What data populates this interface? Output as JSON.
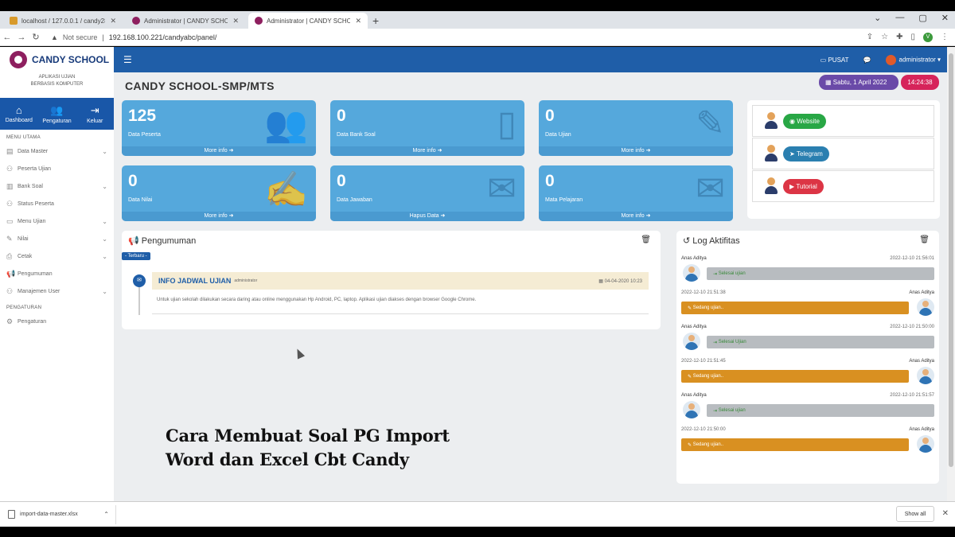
{
  "browser": {
    "tabs": [
      {
        "title": "localhost / 127.0.0.1 / candy28...",
        "active": false
      },
      {
        "title": "Administrator | CANDY SCHOOL",
        "active": false
      },
      {
        "title": "Administrator | CANDY SCHOOL",
        "active": true
      }
    ],
    "new_tab": "+",
    "secure_label": "Not secure",
    "url": "192.168.100.221/candyabc/panel/"
  },
  "sidebar": {
    "brand": "CANDY SCHOOL",
    "tagline": "APLIKASI UJIAN\nBERBASIS KOMPUTER",
    "quick": [
      {
        "label": "Dashboard",
        "icon": "home-icon"
      },
      {
        "label": "Pengaturan",
        "icon": "users-cog-icon"
      },
      {
        "label": "Keluar",
        "icon": "sign-out-icon"
      }
    ],
    "main_header": "MENU UTAMA",
    "items": [
      {
        "label": "Data Master",
        "icon": "database-icon",
        "chevron": true
      },
      {
        "label": "Peserta Ujian",
        "icon": "users-icon",
        "chevron": false
      },
      {
        "label": "Bank Soal",
        "icon": "book-icon",
        "chevron": true
      },
      {
        "label": "Status Peserta",
        "icon": "status-icon",
        "chevron": false
      },
      {
        "label": "Menu Ujian",
        "icon": "monitor-icon",
        "chevron": true
      },
      {
        "label": "Nilai",
        "icon": "grade-icon",
        "chevron": true
      },
      {
        "label": "Cetak",
        "icon": "print-icon",
        "chevron": true
      },
      {
        "label": "Pengumuman",
        "icon": "bullhorn-icon",
        "chevron": false
      },
      {
        "label": "Manajemen User",
        "icon": "user-admin-icon",
        "chevron": true
      }
    ],
    "settings_header": "PENGATURAN",
    "settings_items": [
      {
        "label": "Pengaturan",
        "icon": "settings-icon"
      }
    ]
  },
  "topnav": {
    "pusat_label": "PUSAT",
    "user_label": "administrator"
  },
  "header": {
    "title": "CANDY SCHOOL-SMP/MTS",
    "date": "Sabtu, 1 April 2022",
    "time": "14:24:38"
  },
  "cards": [
    {
      "value": "125",
      "label": "Data Peserta",
      "more": "More info",
      "icon": "users-icon"
    },
    {
      "value": "0",
      "label": "Data Bank Soal",
      "more": "More info",
      "icon": "file-icon"
    },
    {
      "value": "0",
      "label": "Data Ujian",
      "more": "More info",
      "icon": "edit-icon"
    },
    {
      "value": "0",
      "label": "Data Nilai",
      "more": "More info",
      "icon": "signature-icon"
    },
    {
      "value": "0",
      "label": "Data Jawaban",
      "more": "Hapus Data",
      "icon": "envelope-icon"
    },
    {
      "value": "0",
      "label": "Mata Pelajaran",
      "more": "More info",
      "icon": "envelope-open-icon"
    }
  ],
  "links": [
    {
      "label": "Website",
      "color": "#28a745",
      "icon": "globe-icon"
    },
    {
      "label": "Telegram",
      "color": "#2a7fb0",
      "icon": "telegram-icon"
    },
    {
      "label": "Tutorial",
      "color": "#dc3545",
      "icon": "youtube-icon"
    }
  ],
  "announcement": {
    "panel_title": "Pengumuman",
    "badge": "- Terbaru -",
    "title": "INFO JADWAL UJIAN",
    "author": "administrator",
    "date": "04-04-2020 10:23",
    "body": "Untuk ujian sekolah dilakukan secara daring atau online menggunakan Hp Android, PC, laptop. Aplikasi ujian diakses dengan browser Google Chrome."
  },
  "log": {
    "panel_title": "Log Aktifitas",
    "entries": [
      {
        "name": "Anas Aditya",
        "time": "2022-12-10 21:56:01",
        "msg": "Selesai ujian",
        "type": "done",
        "side": "left"
      },
      {
        "name": "Anas Aditya",
        "time": "2022-12-10 21:51:38",
        "msg": "Sedang ujian..",
        "type": "work",
        "side": "right"
      },
      {
        "name": "Anas Aditya",
        "time": "2022-12-10 21:50:00",
        "msg": "Selesai Ujian",
        "type": "done",
        "side": "left"
      },
      {
        "name": "Anas Aditya",
        "time": "2022-12-10 21:51:45",
        "msg": "Sedang ujian..",
        "type": "work",
        "side": "right"
      },
      {
        "name": "Anas Aditya",
        "time": "2022-12-10 21:51:57",
        "msg": "Selesai ujian",
        "type": "done",
        "side": "left"
      },
      {
        "name": "Anas Aditya",
        "time": "2022-12-10 21:50:00",
        "msg": "Sedang ujian..",
        "type": "work",
        "side": "right"
      }
    ]
  },
  "downloads": {
    "file": "import-data-master.xlsx",
    "show_all": "Show all"
  },
  "caption": {
    "line1": "Cara Membuat Soal PG Import",
    "line2": "Word dan Excel Cbt Candy"
  }
}
